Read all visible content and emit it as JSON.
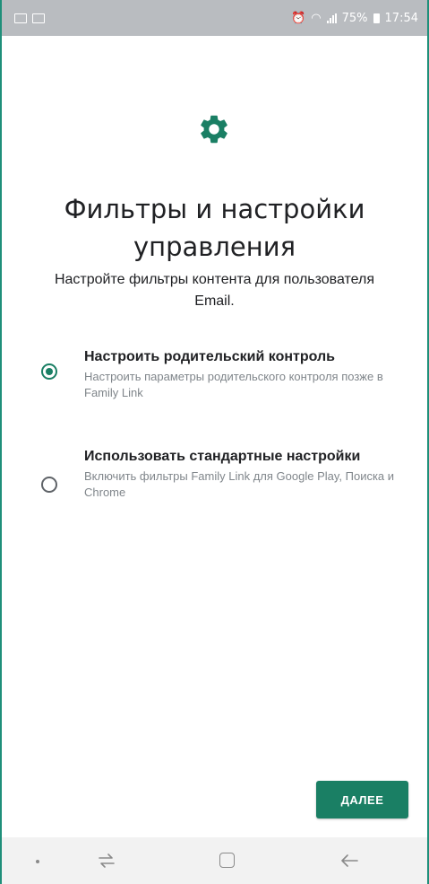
{
  "status_bar": {
    "battery": "75%",
    "time": "17:54"
  },
  "icons": {
    "header": "gear-icon"
  },
  "screen": {
    "title": "Фильтры и настройки управления",
    "subtitle": "Настройте фильтры контента для пользователя Email."
  },
  "options": [
    {
      "title": "Настроить родительский контроль",
      "description": "Настроить параметры родительского контроля позже в Family Link",
      "selected": true
    },
    {
      "title": "Использовать стандартные настройки",
      "description": "Включить фильтры Family Link для Google Play, Поиска и Chrome",
      "selected": false
    }
  ],
  "actions": {
    "next_label": "ДАЛЕЕ"
  },
  "colors": {
    "accent": "#1a7f64",
    "status_bar": "#b9bcc0"
  }
}
